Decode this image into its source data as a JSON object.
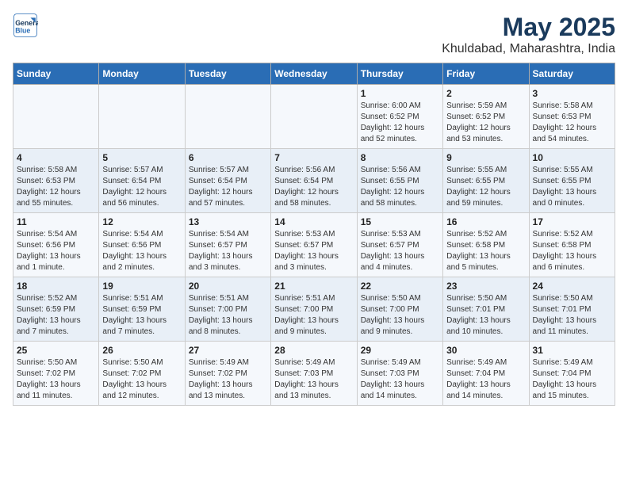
{
  "header": {
    "logo_line1": "General",
    "logo_line2": "Blue",
    "title": "May 2025",
    "subtitle": "Khuldabad, Maharashtra, India"
  },
  "days_of_week": [
    "Sunday",
    "Monday",
    "Tuesday",
    "Wednesday",
    "Thursday",
    "Friday",
    "Saturday"
  ],
  "weeks": [
    [
      {
        "num": "",
        "detail": ""
      },
      {
        "num": "",
        "detail": ""
      },
      {
        "num": "",
        "detail": ""
      },
      {
        "num": "",
        "detail": ""
      },
      {
        "num": "1",
        "detail": "Sunrise: 6:00 AM\nSunset: 6:52 PM\nDaylight: 12 hours\nand 52 minutes."
      },
      {
        "num": "2",
        "detail": "Sunrise: 5:59 AM\nSunset: 6:52 PM\nDaylight: 12 hours\nand 53 minutes."
      },
      {
        "num": "3",
        "detail": "Sunrise: 5:58 AM\nSunset: 6:53 PM\nDaylight: 12 hours\nand 54 minutes."
      }
    ],
    [
      {
        "num": "4",
        "detail": "Sunrise: 5:58 AM\nSunset: 6:53 PM\nDaylight: 12 hours\nand 55 minutes."
      },
      {
        "num": "5",
        "detail": "Sunrise: 5:57 AM\nSunset: 6:54 PM\nDaylight: 12 hours\nand 56 minutes."
      },
      {
        "num": "6",
        "detail": "Sunrise: 5:57 AM\nSunset: 6:54 PM\nDaylight: 12 hours\nand 57 minutes."
      },
      {
        "num": "7",
        "detail": "Sunrise: 5:56 AM\nSunset: 6:54 PM\nDaylight: 12 hours\nand 58 minutes."
      },
      {
        "num": "8",
        "detail": "Sunrise: 5:56 AM\nSunset: 6:55 PM\nDaylight: 12 hours\nand 58 minutes."
      },
      {
        "num": "9",
        "detail": "Sunrise: 5:55 AM\nSunset: 6:55 PM\nDaylight: 12 hours\nand 59 minutes."
      },
      {
        "num": "10",
        "detail": "Sunrise: 5:55 AM\nSunset: 6:55 PM\nDaylight: 13 hours\nand 0 minutes."
      }
    ],
    [
      {
        "num": "11",
        "detail": "Sunrise: 5:54 AM\nSunset: 6:56 PM\nDaylight: 13 hours\nand 1 minute."
      },
      {
        "num": "12",
        "detail": "Sunrise: 5:54 AM\nSunset: 6:56 PM\nDaylight: 13 hours\nand 2 minutes."
      },
      {
        "num": "13",
        "detail": "Sunrise: 5:54 AM\nSunset: 6:57 PM\nDaylight: 13 hours\nand 3 minutes."
      },
      {
        "num": "14",
        "detail": "Sunrise: 5:53 AM\nSunset: 6:57 PM\nDaylight: 13 hours\nand 3 minutes."
      },
      {
        "num": "15",
        "detail": "Sunrise: 5:53 AM\nSunset: 6:57 PM\nDaylight: 13 hours\nand 4 minutes."
      },
      {
        "num": "16",
        "detail": "Sunrise: 5:52 AM\nSunset: 6:58 PM\nDaylight: 13 hours\nand 5 minutes."
      },
      {
        "num": "17",
        "detail": "Sunrise: 5:52 AM\nSunset: 6:58 PM\nDaylight: 13 hours\nand 6 minutes."
      }
    ],
    [
      {
        "num": "18",
        "detail": "Sunrise: 5:52 AM\nSunset: 6:59 PM\nDaylight: 13 hours\nand 7 minutes."
      },
      {
        "num": "19",
        "detail": "Sunrise: 5:51 AM\nSunset: 6:59 PM\nDaylight: 13 hours\nand 7 minutes."
      },
      {
        "num": "20",
        "detail": "Sunrise: 5:51 AM\nSunset: 7:00 PM\nDaylight: 13 hours\nand 8 minutes."
      },
      {
        "num": "21",
        "detail": "Sunrise: 5:51 AM\nSunset: 7:00 PM\nDaylight: 13 hours\nand 9 minutes."
      },
      {
        "num": "22",
        "detail": "Sunrise: 5:50 AM\nSunset: 7:00 PM\nDaylight: 13 hours\nand 9 minutes."
      },
      {
        "num": "23",
        "detail": "Sunrise: 5:50 AM\nSunset: 7:01 PM\nDaylight: 13 hours\nand 10 minutes."
      },
      {
        "num": "24",
        "detail": "Sunrise: 5:50 AM\nSunset: 7:01 PM\nDaylight: 13 hours\nand 11 minutes."
      }
    ],
    [
      {
        "num": "25",
        "detail": "Sunrise: 5:50 AM\nSunset: 7:02 PM\nDaylight: 13 hours\nand 11 minutes."
      },
      {
        "num": "26",
        "detail": "Sunrise: 5:50 AM\nSunset: 7:02 PM\nDaylight: 13 hours\nand 12 minutes."
      },
      {
        "num": "27",
        "detail": "Sunrise: 5:49 AM\nSunset: 7:02 PM\nDaylight: 13 hours\nand 13 minutes."
      },
      {
        "num": "28",
        "detail": "Sunrise: 5:49 AM\nSunset: 7:03 PM\nDaylight: 13 hours\nand 13 minutes."
      },
      {
        "num": "29",
        "detail": "Sunrise: 5:49 AM\nSunset: 7:03 PM\nDaylight: 13 hours\nand 14 minutes."
      },
      {
        "num": "30",
        "detail": "Sunrise: 5:49 AM\nSunset: 7:04 PM\nDaylight: 13 hours\nand 14 minutes."
      },
      {
        "num": "31",
        "detail": "Sunrise: 5:49 AM\nSunset: 7:04 PM\nDaylight: 13 hours\nand 15 minutes."
      }
    ]
  ]
}
